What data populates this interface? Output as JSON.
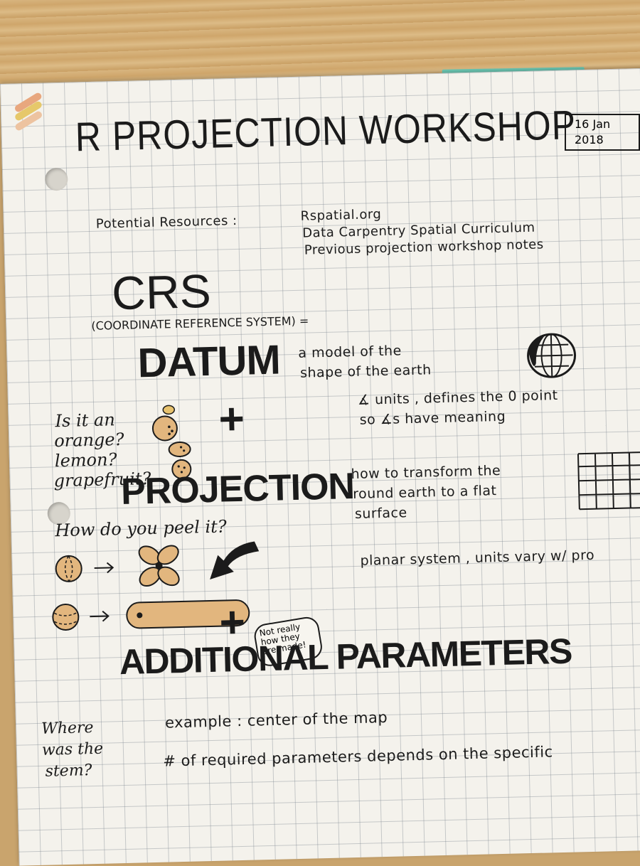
{
  "title": "R PROJECTION WORKSHOP",
  "date": {
    "line1": "16 Jan",
    "line2": "2018"
  },
  "resources": {
    "label": "Potential Resources :",
    "items": [
      "Rspatial.org",
      "Data Carpentry Spatial Curriculum",
      "Previous projection workshop notes"
    ]
  },
  "crs": {
    "heading": "CRS",
    "expansion": "(COORDINATE REFERENCE SYSTEM) ="
  },
  "datum": {
    "heading": "DATUM",
    "desc_line1": "a model of the",
    "desc_line2": "shape of the earth",
    "note_line1": "∡ units , defines the 0 point",
    "note_line2": "so ∡s have meaning"
  },
  "fruit_question": {
    "line1": "Is it an",
    "line2": "orange?",
    "line3": "lemon?",
    "line4": "grapefruit?"
  },
  "plus": "+",
  "projection": {
    "heading": "PROJECTION",
    "desc_line1": "how to transform the",
    "desc_line2": "round earth to a flat",
    "desc_line3": "surface",
    "note": "planar system , units vary w/ pro",
    "peel_question": "How do you peel it?",
    "callout_line1": "Not really",
    "callout_line2": "how they",
    "callout_line3": "are made!"
  },
  "additional": {
    "heading": "ADDITIONAL PARAMETERS",
    "example": "example : center of the map",
    "required": "# of required parameters depends on the specific"
  },
  "stem_question": {
    "line1": "Where",
    "line2": "was the",
    "line3": "stem?"
  },
  "colors": {
    "ink": "#1b1b1b",
    "fruit": "#e2b67e",
    "desk": "#cfa66b",
    "sticky_note": "#6fcdb8",
    "paper": "#f4f2ec"
  }
}
